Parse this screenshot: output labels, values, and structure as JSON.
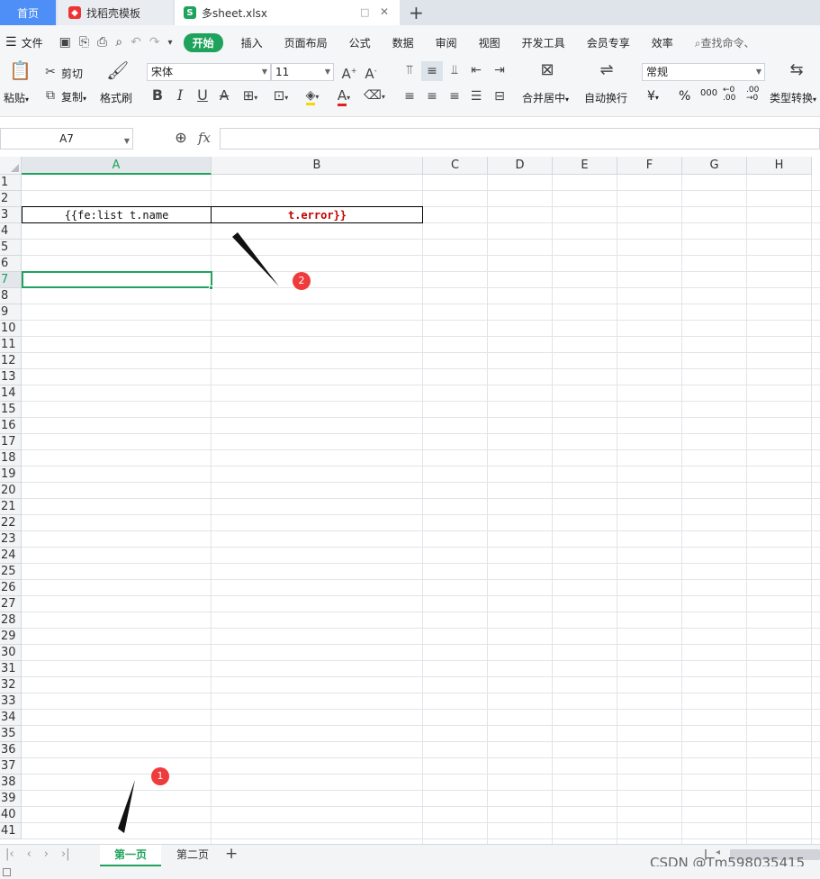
{
  "tabs": {
    "home": "首页",
    "doc1": "找稻壳模板",
    "doc2": "多sheet.xlsx",
    "new": "+",
    "close": "✕",
    "window": "□"
  },
  "menu": {
    "file": "文件",
    "items": [
      "开始",
      "插入",
      "页面布局",
      "公式",
      "数据",
      "审阅",
      "视图",
      "开发工具",
      "会员专享",
      "效率"
    ],
    "search": "查找命令、"
  },
  "ribbon": {
    "paste": "粘贴",
    "cut": "剪切",
    "copy": "复制",
    "format_painter": "格式刷",
    "font_name": "宋体",
    "font_size": "11",
    "merge_center": "合并居中",
    "wrap_text": "自动换行",
    "number_format": "常规",
    "type_convert": "类型转换",
    "currency": "¥",
    "percent": "%",
    "thousands": "000"
  },
  "formula_bar": {
    "cell_ref": "A7",
    "fx": "fx",
    "value": ""
  },
  "columns": [
    "A",
    "B",
    "C",
    "D",
    "E",
    "F",
    "G",
    "H"
  ],
  "rows": [
    "1",
    "2",
    "3",
    "4",
    "5",
    "6",
    "7",
    "8",
    "9",
    "10",
    "11",
    "12",
    "13",
    "14",
    "15",
    "16",
    "17",
    "18",
    "19",
    "20",
    "21",
    "22",
    "23",
    "24",
    "25",
    "26",
    "27",
    "28",
    "29",
    "30",
    "31",
    "32",
    "33",
    "34",
    "35",
    "36",
    "37",
    "38",
    "39",
    "40",
    "41"
  ],
  "cells": {
    "A3": "{{fe:list t.name",
    "B3": "t.error}}"
  },
  "sheets": [
    "第一页",
    "第二页"
  ],
  "annotations": {
    "badge1": "1",
    "badge2": "2"
  },
  "watermark": "CSDN @Tm598035415",
  "colors": {
    "accent": "#1fa35c",
    "tab_active": "#4e8ef7",
    "error_text": "#c00000",
    "annotation": "#ef3b3b"
  }
}
